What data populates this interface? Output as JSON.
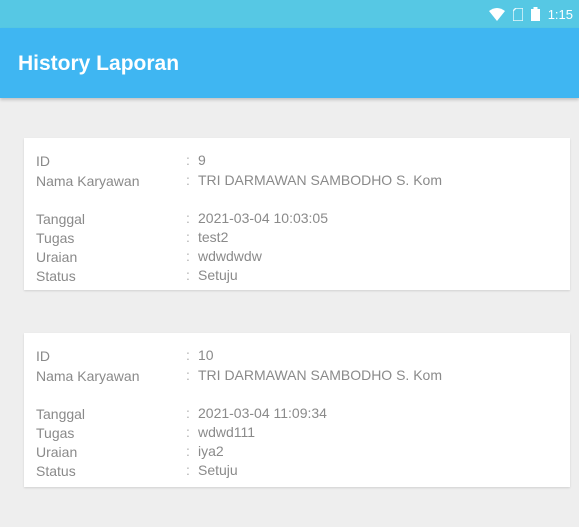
{
  "statusbar": {
    "icons": [
      "wifi-icon",
      "no-sim-icon",
      "battery-icon"
    ],
    "time": "1:15"
  },
  "appbar": {
    "title": "History Laporan"
  },
  "labels": {
    "id": "ID",
    "nama": "Nama Karyawan",
    "tanggal": "Tanggal",
    "tugas": "Tugas",
    "uraian": "Uraian",
    "status": "Status",
    "separator": ":"
  },
  "reports": [
    {
      "id": "9",
      "nama": "TRI DARMAWAN SAMBODHO S. Kom",
      "tanggal": "2021-03-04 10:03:05",
      "tugas": "test2",
      "uraian": "wdwdwdw",
      "status": "Setuju"
    },
    {
      "id": "10",
      "nama": "TRI DARMAWAN SAMBODHO S. Kom",
      "tanggal": "2021-03-04 11:09:34",
      "tugas": "wdwd111",
      "uraian": "iya2",
      "status": "Setuju"
    }
  ],
  "colors": {
    "statusbar": "#56c8e4",
    "appbar": "#3fb6f2",
    "background": "#eeeeee",
    "card": "#ffffff",
    "text": "#8a8a8a"
  }
}
